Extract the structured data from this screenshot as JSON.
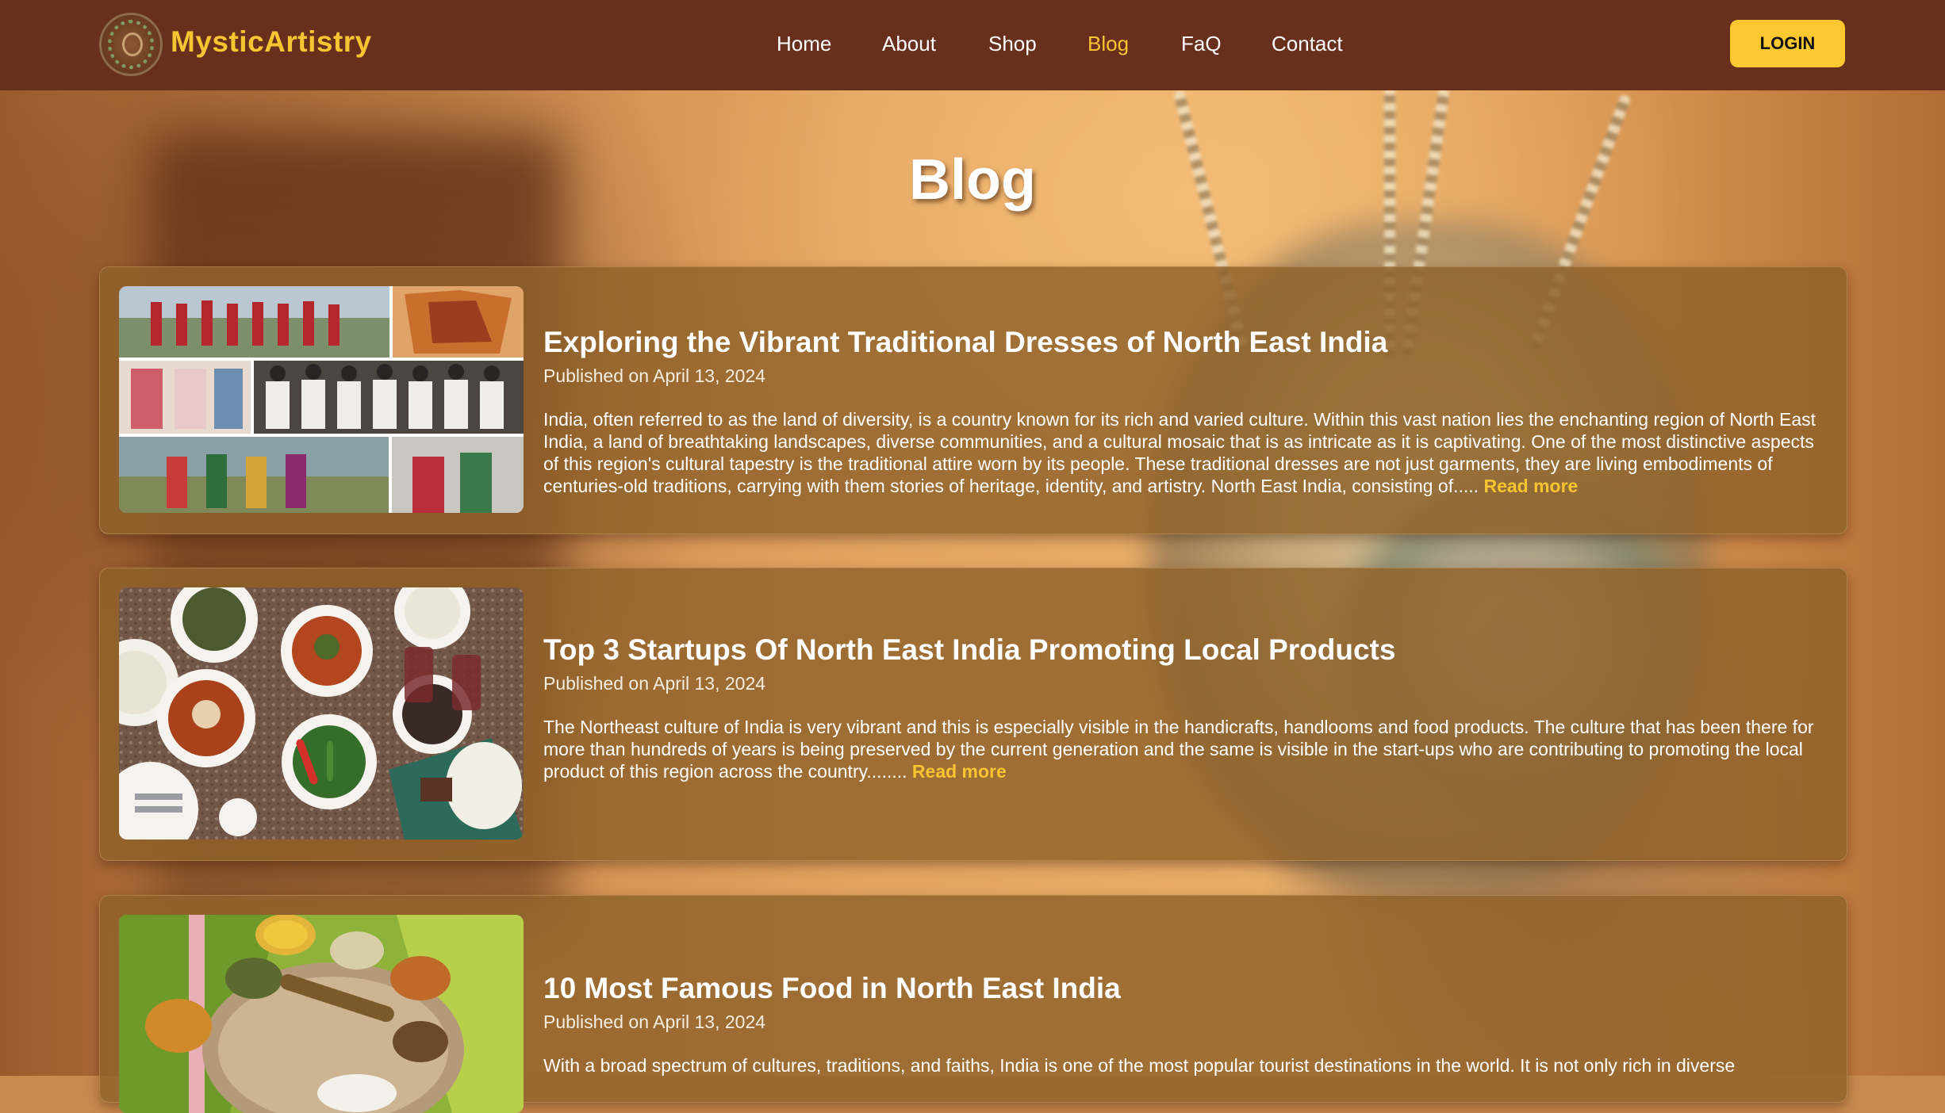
{
  "header": {
    "brand": "MysticArtistry",
    "nav": [
      {
        "label": "Home"
      },
      {
        "label": "About"
      },
      {
        "label": "Shop"
      },
      {
        "label": "Blog",
        "active": true
      },
      {
        "label": "FaQ"
      },
      {
        "label": "Contact"
      }
    ],
    "login_label": "LOGIN"
  },
  "page": {
    "title": "Blog"
  },
  "posts": [
    {
      "title": "Exploring the Vibrant Traditional Dresses of North East India",
      "date": "Published on April 13, 2024",
      "excerpt": "India, often referred to as the land of diversity, is a country known for its rich and varied culture. Within this vast nation lies the enchanting region of North East India, a land of breathtaking landscapes, diverse communities, and a cultural mosaic that is as intricate as it is captivating. One of the most distinctive aspects of this region's cultural tapestry is the traditional attire worn by its people. These traditional dresses are not just garments, they are living embodiments of centuries-old traditions, carrying with them stories of heritage, identity, and artistry. North East India, consisting of.....",
      "read_more": "Read more",
      "image": "collage of people in traditional dress"
    },
    {
      "title": "Top 3 Startups Of North East India Promoting Local Products",
      "date": "Published on April 13, 2024",
      "excerpt": "The Northeast culture of India is very vibrant and this is especially visible in the handicrafts, handlooms and food products. The culture that has been there for more than hundreds of years is being preserved by the current generation and the same is visible in the start-ups who are contributing to promoting the local product of this region across the country........",
      "read_more": "Read more",
      "image": "table of regional dishes"
    },
    {
      "title": "10 Most Famous Food in North East India",
      "date": "Published on April 13, 2024",
      "excerpt": "With a broad spectrum of cultures, traditions, and faiths, India is one of the most popular tourist destinations in the world. It is not only rich in diverse",
      "read_more": "",
      "image": "thali platter on banana leaf"
    }
  ],
  "colors": {
    "header_bg": "#68301c",
    "accent": "#f7c532",
    "button": "#fcc830",
    "card_bg": "rgba(143,97,42,0.82)"
  }
}
